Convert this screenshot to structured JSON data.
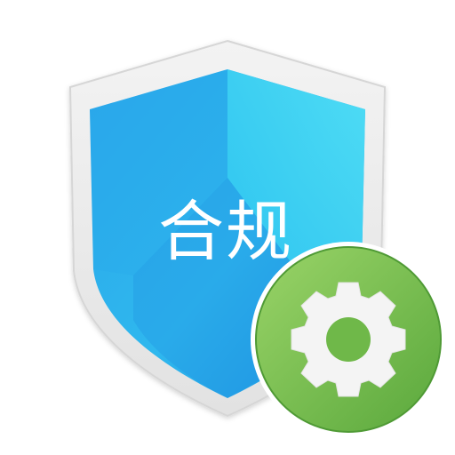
{
  "app_icon": {
    "label": "合规",
    "icons": {
      "shield": "shield-icon",
      "settings_badge": "gear-icon"
    },
    "colors": {
      "shield_rim": "#ececec",
      "shield_rim_edge": "#d9d9d9",
      "shield_blue_light": "#46d9f2",
      "shield_blue_dark": "#1c8fe0",
      "label_text": "#ffffff",
      "badge_green_light": "#93cf63",
      "badge_green_dark": "#5aa83c",
      "gear": "#f4f4f4",
      "gear_hole": "#6fb849"
    }
  }
}
